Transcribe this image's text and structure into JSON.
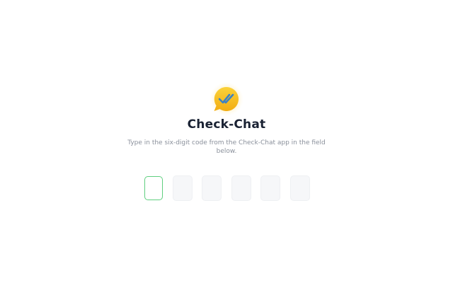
{
  "app": {
    "title": "Check-Chat",
    "instructions": "Type in the six-digit code from the Check-Chat app in the field below.",
    "logo_icon": "chat-bubble-double-check-icon"
  },
  "code": {
    "length": 6,
    "digits": [
      "",
      "",
      "",
      "",
      "",
      ""
    ],
    "active_index": 0
  },
  "colors": {
    "logo_yellow": "#f7c21b",
    "logo_check": "#3b82c4",
    "active_border": "#5fcf7f",
    "title": "#1a2233",
    "subtitle": "#8a909b"
  }
}
